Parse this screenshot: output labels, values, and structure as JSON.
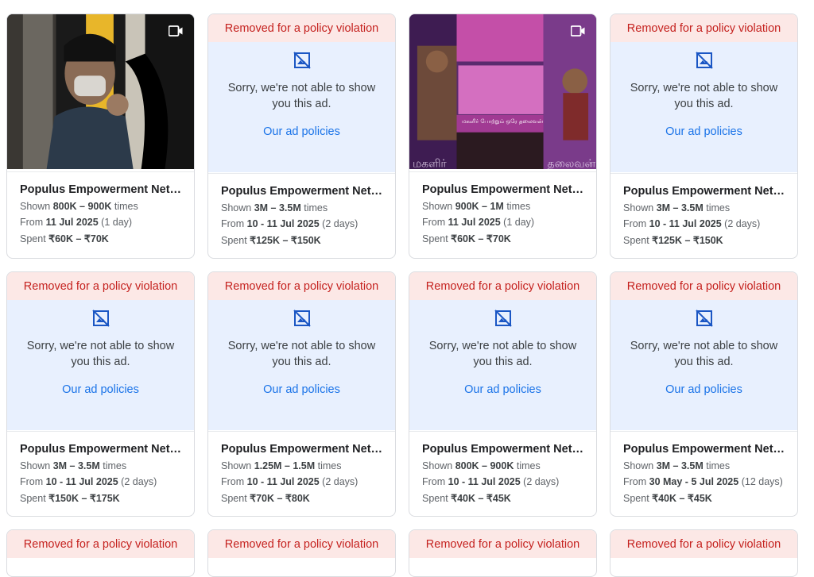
{
  "common": {
    "removed_label": "Removed for a policy violation",
    "sorry_line1": "Sorry, we're not able to show",
    "sorry_line2": "you this ad.",
    "policies_link": "Our ad policies",
    "advertiser": "Populus Empowerment Netw...",
    "shown_prefix": "Shown ",
    "shown_suffix": " times",
    "from_prefix": "From ",
    "spent_prefix": "Spent "
  },
  "cards": [
    {
      "type": "image",
      "shown": "800K – 900K",
      "from": "11 Jul 2025",
      "duration": "(1 day)",
      "spent": "₹60K – ₹70K",
      "icon": "video-camera-icon"
    },
    {
      "type": "removed",
      "shown": "3M – 3.5M",
      "from": "10 - 11 Jul 2025",
      "duration": "(2 days)",
      "spent": "₹125K – ₹150K"
    },
    {
      "type": "image",
      "shown": "900K – 1M",
      "from": "11 Jul 2025",
      "duration": "(1 day)",
      "spent": "₹60K – ₹70K",
      "icon": "video-camera-icon",
      "overlay_text_1": "மகளிர் போற்றும் ஒரே தலைவன்",
      "overlay_text_2": "மகளிர்",
      "overlay_text_3": "தலைவன்"
    },
    {
      "type": "removed",
      "shown": "3M – 3.5M",
      "from": "10 - 11 Jul 2025",
      "duration": "(2 days)",
      "spent": "₹125K – ₹150K"
    },
    {
      "type": "removed",
      "shown": "3M – 3.5M",
      "from": "10 - 11 Jul 2025",
      "duration": "(2 days)",
      "spent": "₹150K – ₹175K"
    },
    {
      "type": "removed",
      "shown": "1.25M – 1.5M",
      "from": "10 - 11 Jul 2025",
      "duration": "(2 days)",
      "spent": "₹70K – ₹80K"
    },
    {
      "type": "removed",
      "shown": "800K – 900K",
      "from": "10 - 11 Jul 2025",
      "duration": "(2 days)",
      "spent": "₹40K – ₹45K"
    },
    {
      "type": "removed",
      "shown": "3M – 3.5M",
      "from": "30 May - 5 Jul 2025",
      "duration": "(12 days)",
      "spent": "₹40K – ₹45K"
    },
    {
      "type": "removed-partial"
    },
    {
      "type": "removed-partial"
    },
    {
      "type": "removed-partial"
    },
    {
      "type": "removed-partial"
    }
  ]
}
